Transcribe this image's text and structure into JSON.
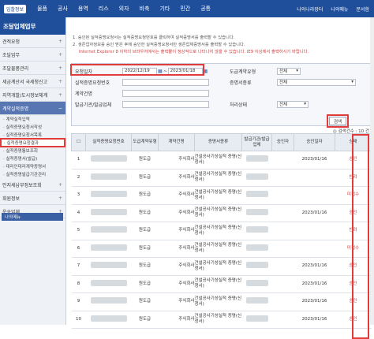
{
  "topbar": {
    "home": "입찰정보",
    "menu": [
      "물품",
      "공사",
      "용역",
      "리스",
      "외자",
      "비축",
      "기타",
      "민간",
      "공통"
    ],
    "right": [
      "나의나라장터",
      "나의메뉴",
      "문서함"
    ]
  },
  "sidebar": {
    "title": "조달업체업무",
    "items": [
      {
        "label": "견적요청",
        "plus": true
      },
      {
        "label": "조달업무",
        "plus": true
      },
      {
        "label": "조달물품관리",
        "plus": true
      },
      {
        "label": "세금계산서 국세청신고",
        "plus": true
      },
      {
        "label": "지역개발/도시정보체계",
        "plus": true
      }
    ],
    "active": "계약실적증명",
    "subs": [
      "· 계약실적입력",
      "· 실적증명요청서작성",
      "· 실적증명요청서목록",
      "· 실적증명요청결과",
      "· 실적증명통보조회",
      "· 실적증명서(발급)",
      "· 대리인대리계약증명서",
      "· 실적증명발급기관관리"
    ],
    "highlighted_sub": "· 실적증명요청결과",
    "items2": [
      {
        "label": "인지세납부정보조회",
        "plus": true
      },
      {
        "label": "회원정보",
        "plus": true
      },
      {
        "label": "운송업체",
        "plus": true
      }
    ],
    "bottom": "나의메뉴"
  },
  "notices": [
    "1. 승인된 실적증명요청서는 실적증명요청번호를 클릭하여 실적증명서를 출력할 수 있습니다.",
    "2. 생존업자정보를 승인 받은 후에 승인한 실적증명요청서만 생존업체증명서를 출력할 수 있습니다.",
    "Internet Explorer 8 이하의 브라우저에서는 출력물이 정상적으로 나타나지 않을 수 있습니다. IE9 이상에서 출력하시기 바랍니다."
  ],
  "search": {
    "date_label": "요청일자",
    "date_from": "2022/12/19",
    "date_to": "2023/01/18",
    "dash": "~",
    "req_no_label": "실적증명요청번호",
    "contract_name_label": "계약건명",
    "issuer_label": "발급기관/발급업체",
    "contract_type_label": "도급계약유형",
    "contract_type_value": "전체",
    "cert_type_label": "증명서종류",
    "cert_type_value": "전체",
    "status_label": "처리상태",
    "status_value": "전체",
    "search_button": "검색"
  },
  "result_count": "◎ 검색건수 : 10 건",
  "table": {
    "headers": [
      "",
      "실적증명요청번호",
      "도급계약유형",
      "계약건명",
      "증명서종류",
      "발급기관/발급업체",
      "승인자",
      "승인일자",
      "상태"
    ],
    "rows": [
      {
        "no": "1",
        "type": "원도급",
        "company": "주식회사",
        "cert": "건설공사기성실적 증명(신청서)",
        "date": "2023/01/16",
        "status": "승인"
      },
      {
        "no": "2",
        "type": "원도급",
        "company": "주식회사",
        "cert": "건설공사기성실적 증명(신청서)",
        "date": "",
        "status": "반려"
      },
      {
        "no": "3",
        "type": "원도급",
        "company": "주식회사",
        "cert": "건설공사기성실적 증명(신청서)",
        "date": "",
        "status": "미접수"
      },
      {
        "no": "4",
        "type": "원도급",
        "company": "주식회사",
        "cert": "건설공사기성실적 증명(신청서)",
        "date": "2023/01/16",
        "status": "승인"
      },
      {
        "no": "5",
        "type": "원도급",
        "company": "주식회사",
        "cert": "건설공사기성실적 증명(신청서)",
        "date": "",
        "status": "반려"
      },
      {
        "no": "6",
        "type": "원도급",
        "company": "주식회사",
        "cert": "건설공사기성실적 증명(신청서)",
        "date": "",
        "status": "미접수"
      },
      {
        "no": "7",
        "type": "원도급",
        "company": "주식회사",
        "cert": "건설공사기성실적 증명(신청서)",
        "date": "2023/01/16",
        "status": "승인"
      },
      {
        "no": "8",
        "type": "원도급",
        "company": "주식회사",
        "cert": "건설공사기성실적 증명(신청서)",
        "date": "2023/01/16",
        "status": "승인"
      },
      {
        "no": "9",
        "type": "원도급",
        "company": "주식회사",
        "cert": "건설공사기성실적 증명(신청서)",
        "date": "2023/01/16",
        "status": "승인"
      },
      {
        "no": "10",
        "type": "원도급",
        "company": "주식회사",
        "cert": "건설공사기성실적 증명(신청서)",
        "date": "2023/01/16",
        "status": "승인"
      }
    ]
  },
  "colors": {
    "brand": "#1f4e9a",
    "highlight": "#e23b3b"
  }
}
